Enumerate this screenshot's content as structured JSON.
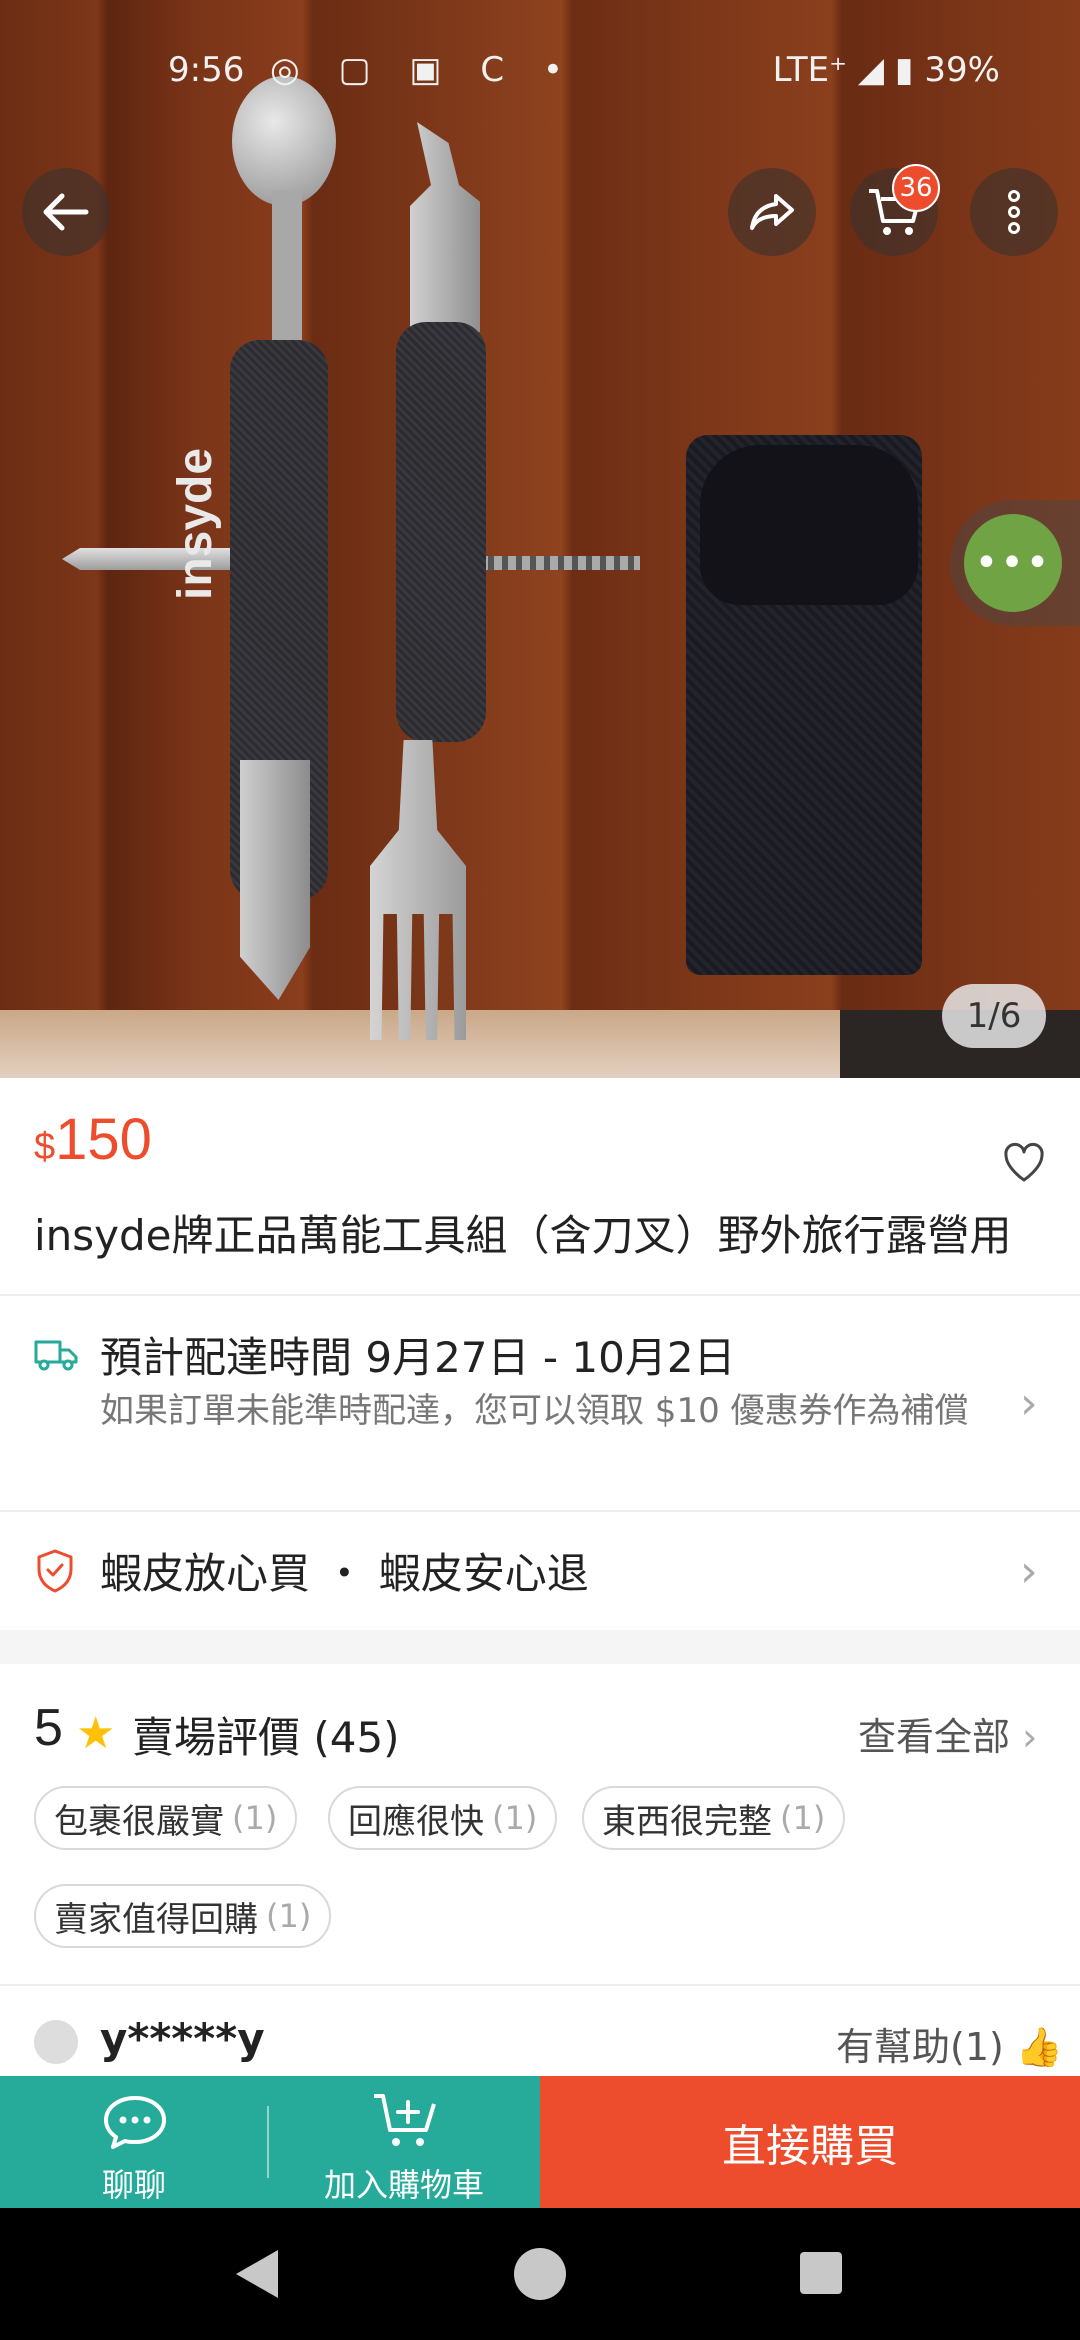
{
  "status_bar": {
    "time": "9:56",
    "notification_icons": [
      "messenger-icon",
      "instagram-icon",
      "teams-icon",
      "c-icon",
      "dot-icon"
    ],
    "network": "LTE⁺",
    "battery": "39%"
  },
  "hero": {
    "cart_badge": "36",
    "chat_label": "•••",
    "image_counter": "1/6",
    "logo_text": "insyde"
  },
  "product": {
    "currency": "$",
    "price": "150",
    "title": "insyde牌正品萬能工具組（含刀叉）野外旅行露營用"
  },
  "shipping": {
    "title": "預計配達時間 9月27日 - 10月2日",
    "subtitle": "如果訂單未能準時配達，您可以領取 $10 優惠券作為補償"
  },
  "guarantee": {
    "label": "蝦皮放心買 ・ 蝦皮安心退"
  },
  "ratings": {
    "score": "5",
    "label": "賣場評價 (45)",
    "see_all": "查看全部",
    "tags": [
      {
        "text": "包裹很嚴實",
        "count": "(1)"
      },
      {
        "text": "回應很快",
        "count": "(1)"
      },
      {
        "text": "東西很完整",
        "count": "(1)"
      },
      {
        "text": "賣家值得回購",
        "count": "(1)"
      }
    ]
  },
  "review": {
    "reviewer": "y*****y",
    "helpful": "有幫助(1)"
  },
  "bottom_bar": {
    "chat_label": "聊聊",
    "add_cart_label": "加入購物車",
    "buy_label": "直接購買"
  },
  "colors": {
    "brand": "#ee4d2d",
    "teal": "#26aa99",
    "star": "#ffc107"
  }
}
